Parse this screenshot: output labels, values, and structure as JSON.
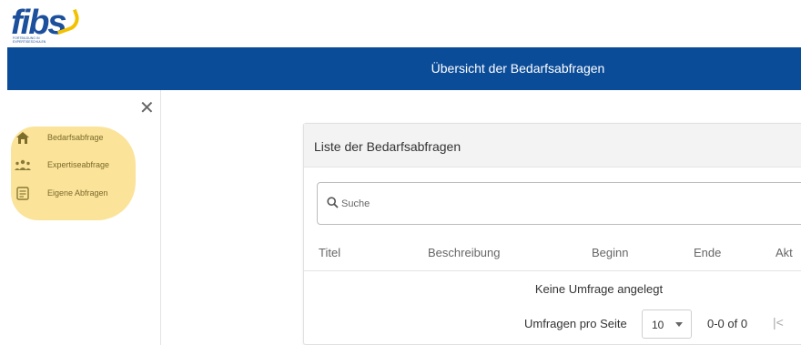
{
  "logo": {
    "text": "fibs",
    "tagline": "FORTBILDUNG IN EXPERTISESCHULEN"
  },
  "header": {
    "title": "Übersicht der Bedarfsabfragen"
  },
  "sidebar": {
    "close_symbol": "✕",
    "highlight_color": "#fbe39a",
    "items": [
      {
        "label": "Bedarfsabfrage",
        "icon": "home-icon"
      },
      {
        "label": "Expertiseabfrage",
        "icon": "people-icon"
      },
      {
        "label": "Eigene Abfragen",
        "icon": "document-icon"
      }
    ]
  },
  "card": {
    "title": "Liste der Bedarfsabfragen",
    "search": {
      "placeholder": "Suche",
      "value": ""
    },
    "columns": [
      "Titel",
      "Beschreibung",
      "Beginn",
      "Ende",
      "Akt"
    ],
    "empty_message": "Keine Umfrage angelegt",
    "pagination": {
      "rows_per_page_label": "Umfragen pro Seite",
      "rows_per_page": "10",
      "range": "0-0 of 0",
      "first_page_symbol": "|<"
    }
  },
  "colors": {
    "brand_blue": "#0b4c99",
    "logo_yellow": "#f2c200"
  }
}
